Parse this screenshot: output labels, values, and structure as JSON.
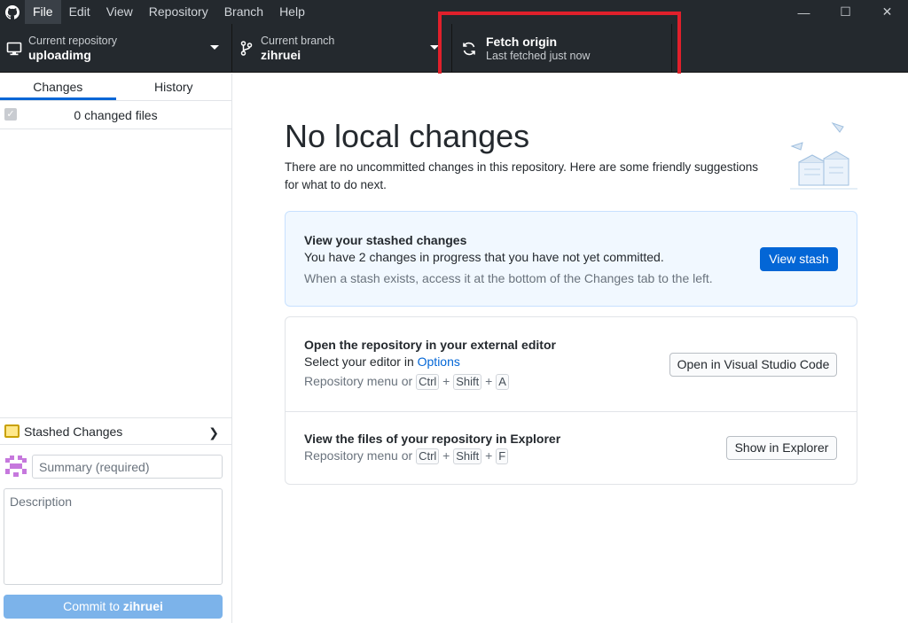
{
  "menu": {
    "items": [
      "File",
      "Edit",
      "View",
      "Repository",
      "Branch",
      "Help"
    ]
  },
  "window": {
    "minimize": "—",
    "maximize": "☐",
    "close": "✕"
  },
  "toolbar": {
    "repo_label": "Current repository",
    "repo_value": "uploadimg",
    "branch_label": "Current branch",
    "branch_value": "zihruei",
    "fetch_title": "Fetch origin",
    "fetch_sub": "Last fetched just now"
  },
  "sidebar": {
    "tabs": [
      "Changes",
      "History"
    ],
    "changed_files": "0 changed files",
    "stashed_label": "Stashed Changes",
    "summary_placeholder": "Summary (required)",
    "description_placeholder": "Description",
    "commit_prefix": "Commit to ",
    "commit_branch": "zihruei"
  },
  "main": {
    "title": "No local changes",
    "subtitle": "There are no uncommitted changes in this repository. Here are some friendly suggestions for what to do next.",
    "stash_card": {
      "title": "View your stashed changes",
      "desc": "You have 2 changes in progress that you have not yet committed.",
      "hint": "When a stash exists, access it at the bottom of the Changes tab to the left.",
      "button": "View stash"
    },
    "editor_card": {
      "title": "Open the repository in your external editor",
      "desc_prefix": "Select your editor in ",
      "desc_link": "Options",
      "hint_prefix": "Repository menu or ",
      "keys": [
        "Ctrl",
        "Shift",
        "A"
      ],
      "button": "Open in Visual Studio Code"
    },
    "explorer_card": {
      "title": "View the files of your repository in Explorer",
      "hint_prefix": "Repository menu or ",
      "keys": [
        "Ctrl",
        "Shift",
        "F"
      ],
      "button": "Show in Explorer"
    }
  },
  "colors": {
    "accent": "#0366d6",
    "toolbar_bg": "#24292e",
    "highlight": "#e0202b"
  }
}
